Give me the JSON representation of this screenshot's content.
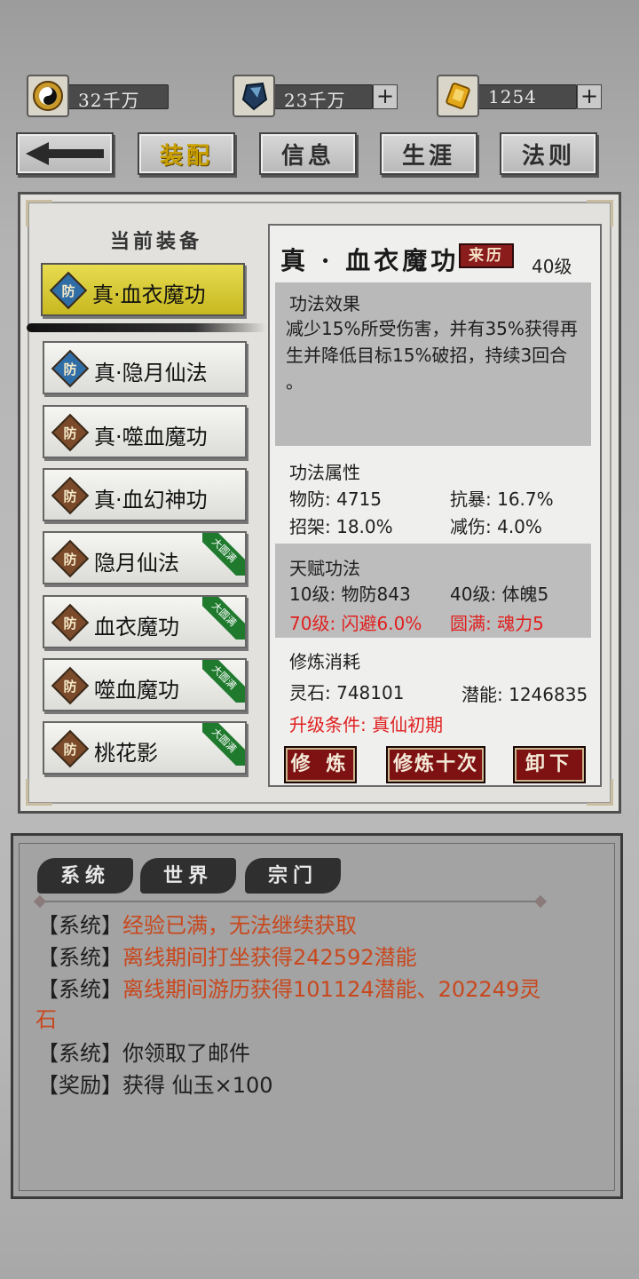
{
  "resources": [
    {
      "icon": "yin-yang-coin-icon",
      "value": "32千万",
      "has_plus": false
    },
    {
      "icon": "blue-crystal-icon",
      "value": "23千万",
      "has_plus": true
    },
    {
      "icon": "gold-ingot-icon",
      "value": "1254",
      "has_plus": true
    }
  ],
  "tabs": {
    "back_icon": "back-arrow-icon",
    "equip": "装配",
    "info": "信息",
    "career": "生涯",
    "rules": "法则"
  },
  "current_equipment": {
    "title": "当前装备",
    "items": [
      {
        "badge": "防",
        "name": "真·血衣魔功",
        "color": "blue",
        "tag": "",
        "active": true
      },
      {
        "badge": "防",
        "name": "真·隐月仙法",
        "color": "blue",
        "tag": ""
      },
      {
        "badge": "防",
        "name": "真·噬血魔功",
        "color": "brown",
        "tag": ""
      },
      {
        "badge": "防",
        "name": "真·血幻神功",
        "color": "brown",
        "tag": ""
      },
      {
        "badge": "防",
        "name": "隐月仙法",
        "color": "brown",
        "tag": "大圆满"
      },
      {
        "badge": "防",
        "name": "血衣魔功",
        "color": "brown",
        "tag": "大圆满"
      },
      {
        "badge": "防",
        "name": "噬血魔功",
        "color": "brown",
        "tag": "大圆满"
      },
      {
        "badge": "防",
        "name": "桃花影",
        "color": "brown",
        "tag": "大圆满"
      }
    ]
  },
  "detail": {
    "title": "真 · 血衣魔功",
    "source_button": "来历",
    "level": "40级",
    "effect_header": "功法效果",
    "effect_lines": [
      "减少15%所受伤害，并有35%获得再",
      "生并降低目标15%破招，持续3回合",
      "。"
    ],
    "attr_header": "功法属性",
    "attrs": {
      "wufang": "物防: 4715",
      "kangbao": "抗暴: 16.7%",
      "zhaojia": "招架: 18.0%",
      "jianshang": "减伤: 4.0%"
    },
    "talent_header": "天赋功法",
    "talents": {
      "t10": "10级: 物防843",
      "t40": "40级: 体魄5",
      "t70": "70级: 闪避6.0%",
      "tfull": "圆满: 魂力5"
    },
    "cost_header": "修炼消耗",
    "spirit_stone": "灵石: 748101",
    "potential": "潜能: 1246835",
    "upgrade_cond": "升级条件: 真仙初期",
    "buttons": {
      "cultivate": "修 炼",
      "cultivate10": "修炼十次",
      "unequip": "卸下"
    }
  },
  "chat": {
    "tabs": [
      "系统",
      "世界",
      "宗门"
    ],
    "messages": [
      {
        "prefix": "【系统】",
        "text": "经验已满，无法继续获取",
        "colored": true
      },
      {
        "prefix": "【系统】",
        "text": "离线期间打坐获得242592潜能",
        "colored": true
      },
      {
        "prefix": "【系统】",
        "text": "离线期间游历获得101124潜能、202249灵",
        "cont": "石",
        "colored": true
      },
      {
        "prefix": "【系统】",
        "text": "你领取了邮件",
        "colored": false
      },
      {
        "prefix": "【奖励】",
        "text": "获得 仙玉×100",
        "colored": false
      }
    ]
  }
}
